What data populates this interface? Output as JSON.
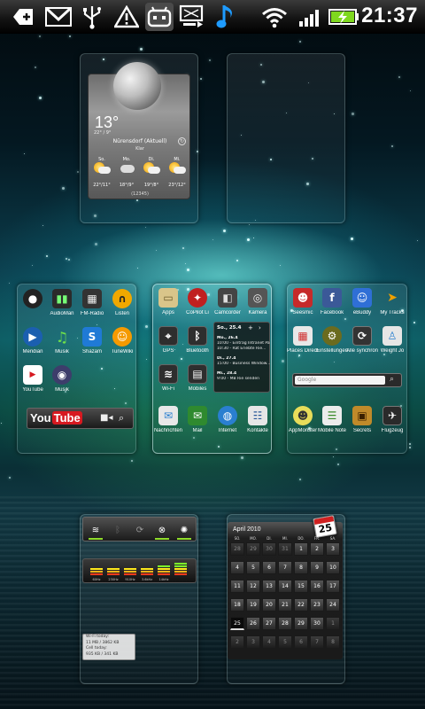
{
  "status_bar": {
    "time": "21:37",
    "icons": [
      "plus-download-icon",
      "gmail-icon",
      "usb-icon",
      "warning-icon",
      "robot-icon",
      "screenshot-icon",
      "music-note-icon",
      "wifi-icon",
      "signal-icon",
      "battery-charging-icon"
    ]
  },
  "weather": {
    "temperature": "13°",
    "min_max": "22° / 9°",
    "location": "Nürensdorf (Aktuell)",
    "condition": "Klar",
    "days": [
      {
        "label": "So.",
        "temps": "22°/11°",
        "icon": "sun-cloud-icon"
      },
      {
        "label": "Mo.",
        "temps": "18°/9°",
        "icon": "cloud-icon"
      },
      {
        "label": "Di.",
        "temps": "19°/8°",
        "icon": "sun-cloud-icon"
      },
      {
        "label": "Mi.",
        "temps": "23°/12°",
        "icon": "sun-cloud-icon"
      }
    ],
    "updated": "(12345)"
  },
  "screen2": {
    "apps": [
      {
        "label": "",
        "icon": "speaker-icon",
        "color": "#222222"
      },
      {
        "label": "AudioMan",
        "icon": "equalizer-icon",
        "color": "#2b2b2b"
      },
      {
        "label": "FM-Radio",
        "icon": "radio-icon",
        "color": "#333333"
      },
      {
        "label": "Listen",
        "icon": "headphones-icon",
        "color": "#f0a800"
      },
      {
        "label": "Meridian",
        "icon": "globe-play-icon",
        "color": "#1b5fb0"
      },
      {
        "label": "Musik",
        "icon": "music-note-icon",
        "color": "#3a9a2a"
      },
      {
        "label": "Shazam",
        "icon": "shazam-icon",
        "color": "#1f7ad6"
      },
      {
        "label": "TuneWiki",
        "icon": "tunewiki-icon",
        "color": "#f59a00"
      },
      {
        "label": "YouTube",
        "icon": "youtube-icon",
        "color": "#d71920"
      },
      {
        "label": "Musik",
        "icon": "speaker-icon",
        "color": "#3d3d6b"
      }
    ],
    "youtube_bar": {
      "logo_left": "You",
      "logo_right": "Tube"
    }
  },
  "screen3": {
    "apps": [
      {
        "label": "Apps",
        "icon": "folder-icon",
        "color": "#d9c58a"
      },
      {
        "label": "CoPilot Li",
        "icon": "copilot-icon",
        "color": "#c02020"
      },
      {
        "label": "Camcorder",
        "icon": "camcorder-icon",
        "color": "#444444"
      },
      {
        "label": "Kamera",
        "icon": "camera-icon",
        "color": "#555555"
      },
      {
        "label": "GPS",
        "icon": "gps-icon",
        "color": "#2e2e2e"
      },
      {
        "label": "Bluetooth",
        "icon": "bluetooth-icon",
        "color": "#2e2e2e"
      },
      {
        "label": "Wi-Fi",
        "icon": "wifi-icon",
        "color": "#2e2e2e"
      },
      {
        "label": "Mobiles",
        "icon": "mobile-data-icon",
        "color": "#2e2e2e"
      },
      {
        "label": "Nachrichten",
        "icon": "messages-icon",
        "color": "#e8e8e8"
      },
      {
        "label": "Mail",
        "icon": "mail-icon",
        "color": "#2f8a2f"
      },
      {
        "label": "Internet",
        "icon": "globe-icon",
        "color": "#2a7fd0"
      },
      {
        "label": "Kontakte",
        "icon": "contacts-icon",
        "color": "#e6e6e6"
      }
    ],
    "agenda": {
      "header": "So., 25.4",
      "rows": [
        {
          "day": "Mo., 26.4",
          "text": "10:00 - Eintrag Intranet Pa..."
        },
        {
          "day": "",
          "text": "10:30 - Rat Eriebte Rie..."
        },
        {
          "day": "Di., 27.4",
          "text": "15:00 - Business Window..."
        },
        {
          "day": "Mi., 28.4",
          "text": "9:00 - MB Rie senden"
        }
      ]
    }
  },
  "screen4": {
    "apps": [
      {
        "label": "Seesmic",
        "icon": "seesmic-icon",
        "color": "#c62a2a"
      },
      {
        "label": "Facebook",
        "icon": "facebook-icon",
        "color": "#3b5998"
      },
      {
        "label": "eBuddy",
        "icon": "ebuddy-icon",
        "color": "#2f6fd6"
      },
      {
        "label": "My Tracks",
        "icon": "my-tracks-icon",
        "color": "#3a3a3a"
      },
      {
        "label": "Places Directory",
        "icon": "places-icon",
        "color": "#e8e8e8"
      },
      {
        "label": "Einstellungen",
        "icon": "settings-icon",
        "color": "#6b6b1f"
      },
      {
        "label": "Alle synchronisieren",
        "icon": "sync-icon",
        "color": "#333333"
      },
      {
        "label": "Weight Jo",
        "icon": "weight-icon",
        "color": "#e6e6e6"
      },
      {
        "label": "AppMonster",
        "icon": "appmonster-icon",
        "color": "#e8dc5a"
      },
      {
        "label": "Mobile Note",
        "icon": "note-icon",
        "color": "#ececec"
      },
      {
        "label": "Secrets",
        "icon": "secrets-icon",
        "color": "#c08a2a"
      },
      {
        "label": "Flugzeug",
        "icon": "airplane-icon",
        "color": "#2a2a2a"
      }
    ],
    "search_placeholder": "Google"
  },
  "screen5": {
    "power_toggles": [
      "wifi-icon",
      "bluetooth-icon",
      "sync-icon",
      "gps-icon",
      "brightness-icon"
    ],
    "equalizer_labels": [
      "60Hz",
      "230Hz",
      "910Hz",
      "3.6kHz",
      "14kHz",
      ""
    ],
    "wifi_stats": [
      "Wi-Fi today:",
      "11 MB / 3862 KB",
      "Cell today:",
      "935 KB / 341 KB"
    ]
  },
  "screen6": {
    "title": "April 2010",
    "badge_day": "25",
    "weekdays": [
      "SO.",
      "MO.",
      "DI.",
      "MI.",
      "DO.",
      "FR.",
      "SA."
    ],
    "weeks": [
      [
        "28",
        "29",
        "30",
        "31",
        "1",
        "2",
        "3"
      ],
      [
        "4",
        "5",
        "6",
        "7",
        "8",
        "9",
        "10"
      ],
      [
        "11",
        "12",
        "13",
        "14",
        "15",
        "16",
        "17"
      ],
      [
        "18",
        "19",
        "20",
        "21",
        "22",
        "23",
        "24"
      ],
      [
        "25",
        "26",
        "27",
        "28",
        "29",
        "30",
        "1"
      ],
      [
        "2",
        "3",
        "4",
        "5",
        "6",
        "7",
        "8"
      ]
    ]
  }
}
